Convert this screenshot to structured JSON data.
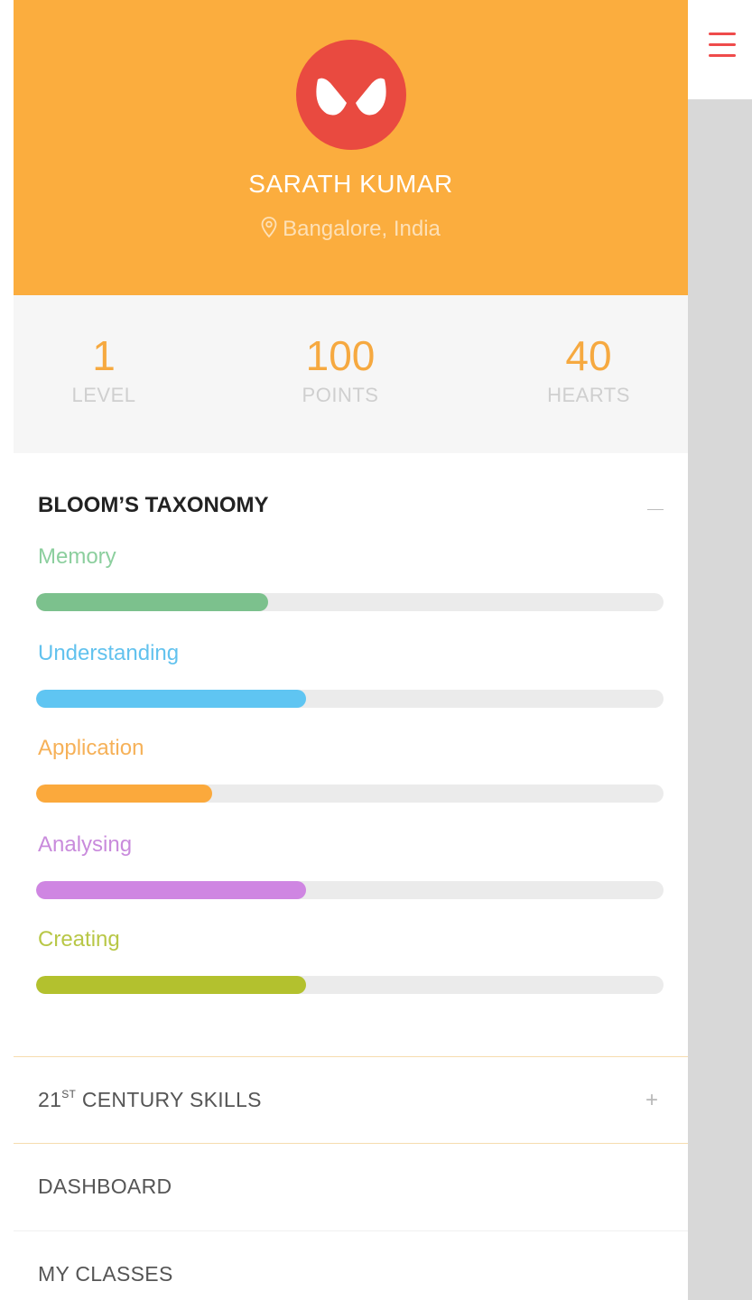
{
  "profile": {
    "name": "SARATH KUMAR",
    "location": "Bangalore, India",
    "avatar_icon": "spider-mask-icon",
    "background_color": "#fbad3e"
  },
  "stats": [
    {
      "value": "1",
      "label": "LEVEL"
    },
    {
      "value": "100",
      "label": "POINTS"
    },
    {
      "value": "40",
      "label": "HEARTS"
    }
  ],
  "bloom": {
    "title": "BLOOM’S TAXONOMY",
    "collapse_icon": "minus-icon",
    "skills": [
      {
        "label": "Memory",
        "progress": 0.37,
        "color": "#7cc18d",
        "label_color": "#8ccf9e"
      },
      {
        "label": "Understanding",
        "progress": 0.43,
        "color": "#5fc5f2",
        "label_color": "#62c2ee"
      },
      {
        "label": "Application",
        "progress": 0.28,
        "color": "#fba93c",
        "label_color": "#f6b158"
      },
      {
        "label": "Analysing",
        "progress": 0.43,
        "color": "#cf86e2",
        "label_color": "#c98bdc"
      },
      {
        "label": "Creating",
        "progress": 0.43,
        "color": "#b3c12e",
        "label_color": "#b8c746"
      }
    ]
  },
  "menu": {
    "century_prefix": "21",
    "century_sup": "ST",
    "century_rest": " CENTURY SKILLS",
    "expand_icon": "plus-icon",
    "dashboard": "DASHBOARD",
    "my_classes": "MY CLASSES"
  },
  "nav": {
    "hamburger_icon": "hamburger-menu-icon",
    "accent": "#ef4b4b"
  }
}
